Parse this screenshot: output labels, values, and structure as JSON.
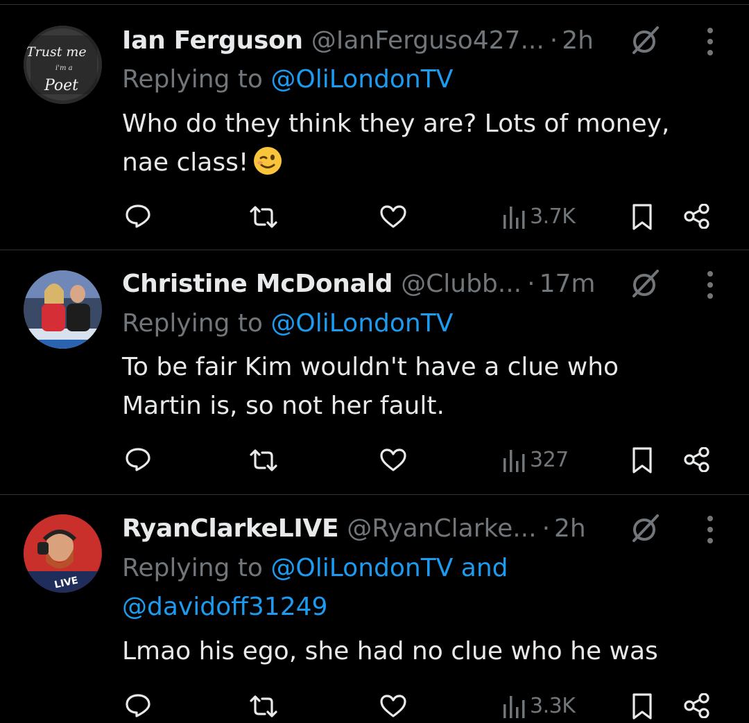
{
  "tweets": [
    {
      "name": "Ian Ferguson",
      "handle": "@IanFerguso427...",
      "dot": "·",
      "time": "2h",
      "reply_prefix": "Replying to",
      "mentions": "@OliLondonTV",
      "mentions_line2": "",
      "text_line1": "Who do they think they are? Lots of money,",
      "text_line2": "nae class!",
      "emoji": "winking-face",
      "views": "3.7K",
      "avatar": {
        "text_top": "Trust me",
        "text_mid": "i'm a",
        "text_bottom": "Poet"
      }
    },
    {
      "name": "Christine McDonald",
      "handle": "@Clubb...",
      "dot": "·",
      "time": "17m",
      "reply_prefix": "Replying to",
      "mentions": "@OliLondonTV",
      "mentions_line2": "",
      "text_line1": "To be fair Kim wouldn't have a clue who",
      "text_line2": "Martin is, so not her fault.",
      "views": "327"
    },
    {
      "name": "RyanClarkeLIVE",
      "handle": "@RyanClarke...",
      "dot": "·",
      "time": "2h",
      "reply_prefix": "Replying to",
      "mentions": "@OliLondonTV and",
      "mentions_line2": "@davidoff31249",
      "text_line1": "Lmao his ego, she had no clue who he was",
      "text_line2": "",
      "views": "3.3K",
      "avatar": {
        "badge": "LIVE"
      }
    }
  ],
  "colors": {
    "background": "#000000",
    "primary_text": "#e7e9ea",
    "secondary_text": "#71767b",
    "link": "#1d9bf0",
    "divider": "#2f3336"
  }
}
